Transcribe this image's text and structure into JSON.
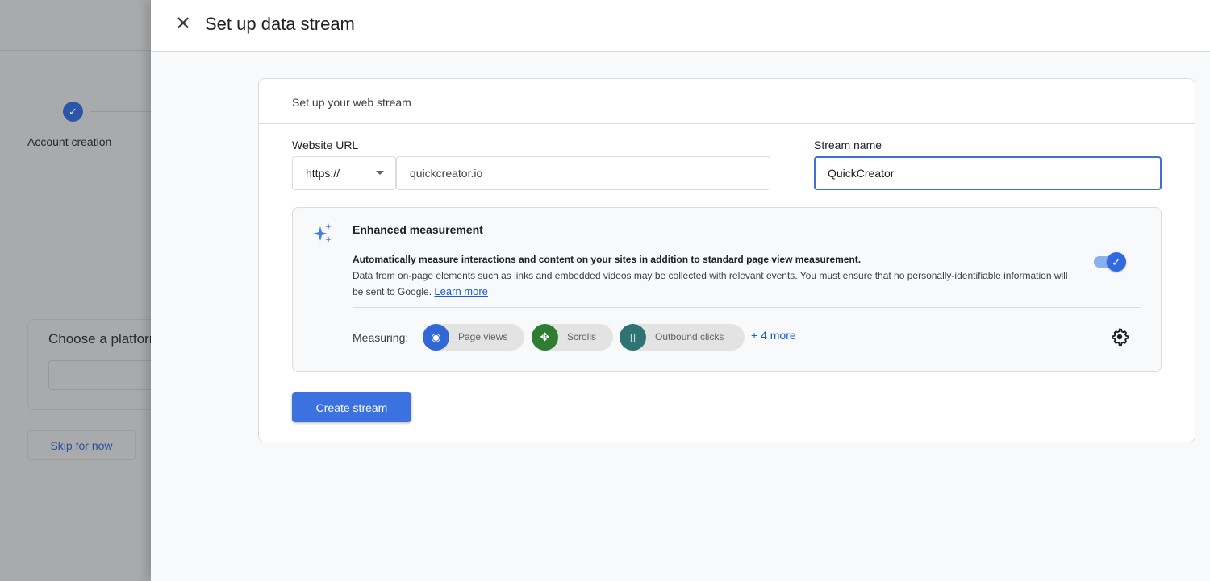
{
  "background": {
    "stepper": {
      "completed_step_label": "Account creation"
    },
    "platform_card": {
      "title": "Choose a platform"
    },
    "skip_label": "Skip for now"
  },
  "panel": {
    "title": "Set up data stream",
    "card": {
      "header": "Set up your web stream",
      "website_url": {
        "label": "Website URL",
        "protocol": "https://",
        "value": "quickcreator.io"
      },
      "stream_name": {
        "label": "Stream name",
        "value": "QuickCreator"
      },
      "enhanced": {
        "title": "Enhanced measurement",
        "description_bold": "Automatically measure interactions and content on your sites in addition to standard page view measurement.",
        "description": "Data from on-page elements such as links and embedded videos may be collected with relevant events. You must ensure that no personally-identifiable information will be sent to Google.",
        "learn_more": "Learn more",
        "enabled": true,
        "measuring_label": "Measuring:",
        "chips": [
          {
            "label": "Page views",
            "icon": "eye-icon",
            "color": "#3367d6"
          },
          {
            "label": "Scrolls",
            "icon": "scroll-arrows-icon",
            "color": "#2e7d32"
          },
          {
            "label": "Outbound clicks",
            "icon": "mouse-icon",
            "color": "#2f7373"
          }
        ],
        "more_label": "+ 4 more"
      },
      "create_button": "Create stream"
    }
  },
  "colors": {
    "accent": "#3c72e0",
    "overlay": "#a9aaac"
  }
}
